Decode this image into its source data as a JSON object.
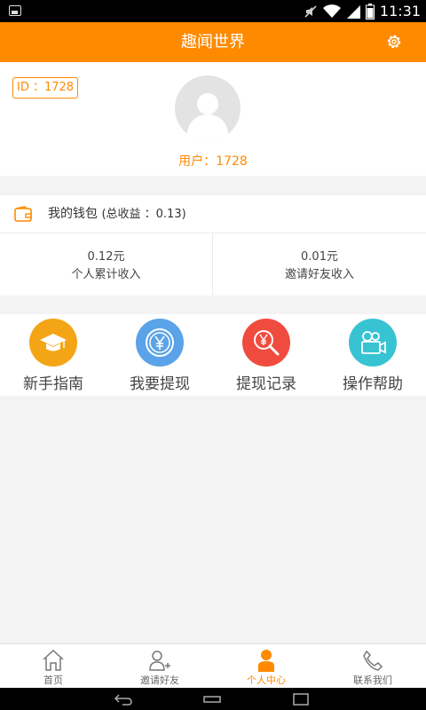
{
  "status_bar": {
    "time": "11:31"
  },
  "header": {
    "title": "趣闻世界"
  },
  "profile": {
    "id_badge": "ID ：1728",
    "username": "用户：1728"
  },
  "wallet": {
    "title": "我的钱包",
    "total": "(总收益 ：0.13)",
    "personal_amount": "0.12元",
    "personal_label": "个人累计收入",
    "invite_amount": "0.01元",
    "invite_label": "邀请好友收入"
  },
  "menu": {
    "items": [
      {
        "label": "新手指南",
        "icon": "graduation-cap-icon",
        "color": "#f4a516"
      },
      {
        "label": "我要提现",
        "icon": "yen-coin-icon",
        "color": "#5aa3e8"
      },
      {
        "label": "提现记录",
        "icon": "yen-search-icon",
        "color": "#f04b3f"
      },
      {
        "label": "操作帮助",
        "icon": "video-camera-icon",
        "color": "#38c3d3"
      }
    ]
  },
  "bottom_nav": {
    "items": [
      {
        "label": "首页",
        "icon": "home-icon"
      },
      {
        "label": "邀请好友",
        "icon": "add-friend-icon"
      },
      {
        "label": "个人中心",
        "icon": "person-icon",
        "active": true
      },
      {
        "label": "联系我们",
        "icon": "phone-icon"
      }
    ]
  },
  "colors": {
    "accent": "#ff8a00",
    "background": "#f3f3f3"
  }
}
